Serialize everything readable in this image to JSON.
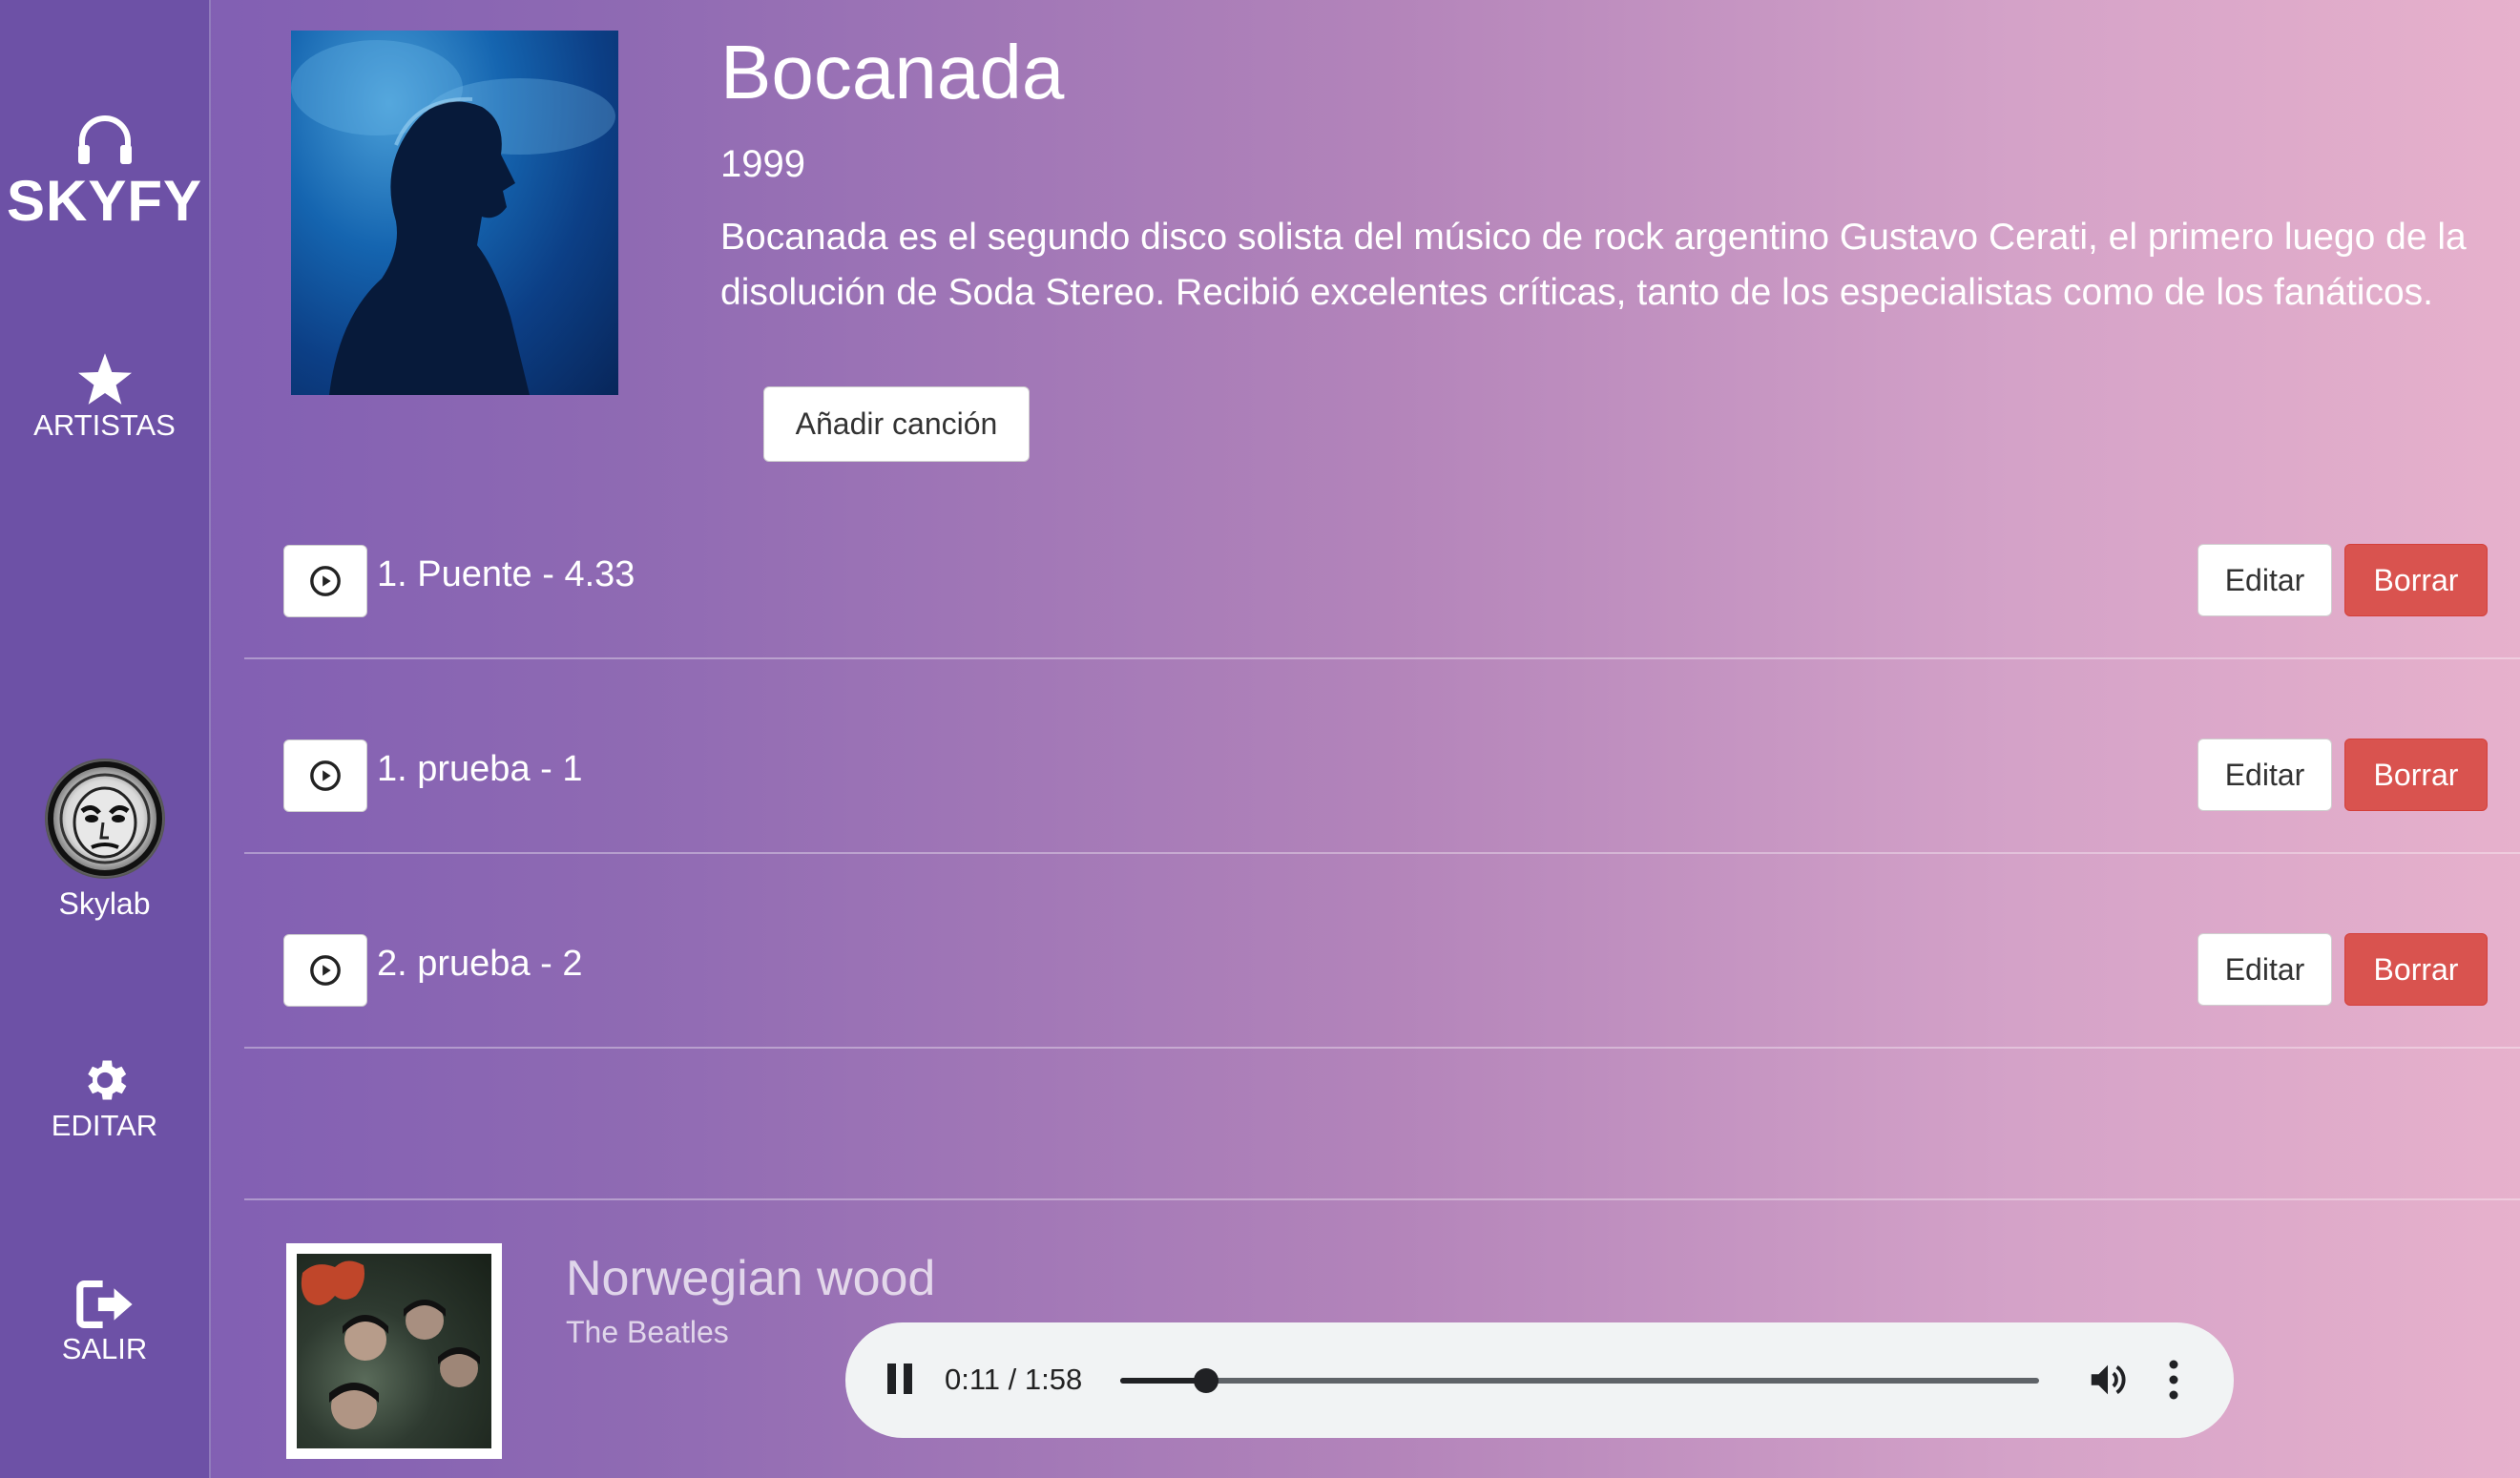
{
  "app": {
    "name": "SKYFY"
  },
  "sidebar": {
    "artists_label": "ARTISTAS",
    "user_name": "Skylab",
    "edit_label": "EDITAR",
    "logout_label": "SALIR"
  },
  "album": {
    "title": "Bocanada",
    "year": "1999",
    "description": "Bocanada es el segundo disco solista del músico de rock argentino Gustavo Cerati, el primero luego de la disolución de Soda Stereo. Recibió excelentes críticas, tanto de los especialistas como de los fanáticos.",
    "add_song_label": "Añadir canción"
  },
  "songs": [
    {
      "title": "1. Puente - 4.33",
      "edit_label": "Editar",
      "delete_label": "Borrar"
    },
    {
      "title": "1. prueba - 1",
      "edit_label": "Editar",
      "delete_label": "Borrar"
    },
    {
      "title": "2. prueba - 2",
      "edit_label": "Editar",
      "delete_label": "Borrar"
    }
  ],
  "now_playing": {
    "title": "Norwegian wood",
    "artist": "The Beatles",
    "time": "0:11 / 1:58",
    "progress": 0.093
  },
  "colors": {
    "sidebar": "#6d51a6",
    "delete": "#d9534f",
    "player": "#f1f3f4"
  }
}
